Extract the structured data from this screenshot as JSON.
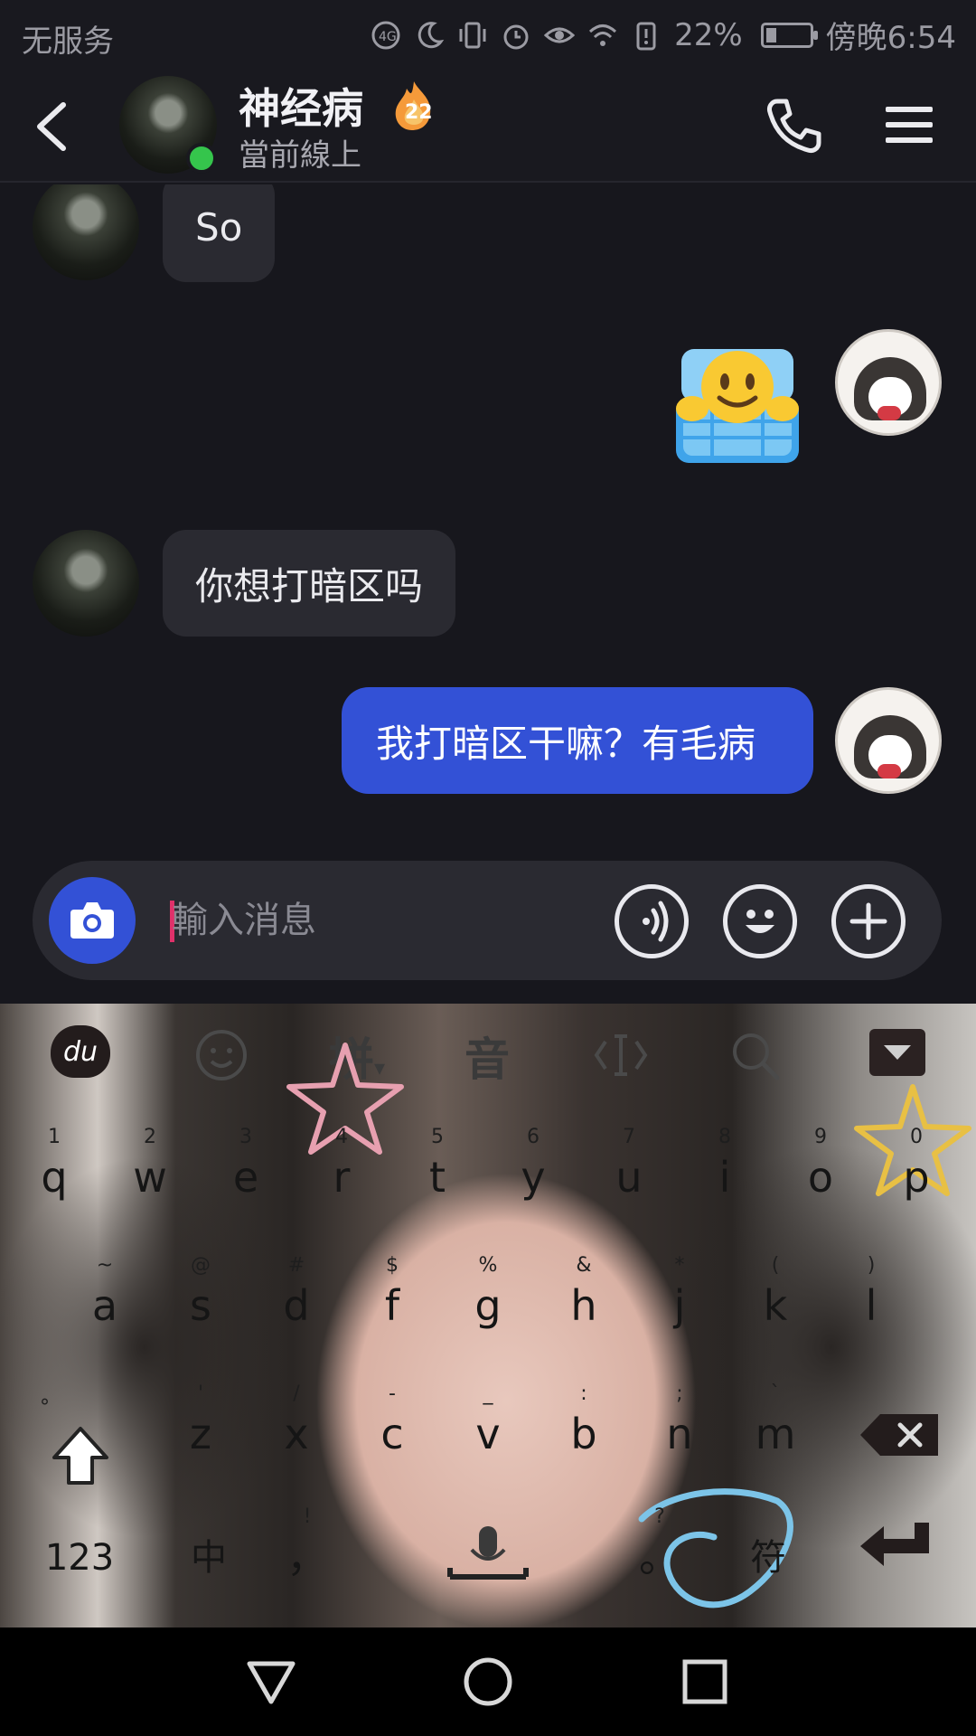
{
  "status_bar": {
    "carrier": "无服务",
    "battery": "22%",
    "time": "傍晚6:54",
    "icons": [
      "data-icon",
      "moon-icon",
      "vibrate-icon",
      "alarm-icon",
      "eye-icon",
      "wifi-icon",
      "battery-alert-icon",
      "battery-icon"
    ]
  },
  "header": {
    "name": "神经病",
    "streak": "22",
    "status": "當前線上"
  },
  "messages": [
    {
      "from": "them",
      "type": "text",
      "text": "So"
    },
    {
      "from": "me",
      "type": "sticker",
      "sticker": "emoji-in-bed-sticker"
    },
    {
      "from": "them",
      "type": "text",
      "text": "你想打暗区吗"
    },
    {
      "from": "me",
      "type": "text",
      "text": "我打暗区干嘛？有毛病"
    }
  ],
  "composer": {
    "placeholder": "輸入消息"
  },
  "keyboard": {
    "toolbar": {
      "brand": "du",
      "pinyin": "拼",
      "voice": "音"
    },
    "row1": [
      {
        "hint": "1",
        "key": "q"
      },
      {
        "hint": "2",
        "key": "w"
      },
      {
        "hint": "3",
        "key": "e"
      },
      {
        "hint": "4",
        "key": "r"
      },
      {
        "hint": "5",
        "key": "t"
      },
      {
        "hint": "6",
        "key": "y"
      },
      {
        "hint": "7",
        "key": "u"
      },
      {
        "hint": "8",
        "key": "i"
      },
      {
        "hint": "9",
        "key": "o"
      },
      {
        "hint": "0",
        "key": "p"
      }
    ],
    "row2": [
      {
        "hint": "~",
        "key": "a"
      },
      {
        "hint": "@",
        "key": "s"
      },
      {
        "hint": "#",
        "key": "d"
      },
      {
        "hint": "$",
        "key": "f"
      },
      {
        "hint": "%",
        "key": "g"
      },
      {
        "hint": "&",
        "key": "h"
      },
      {
        "hint": "*",
        "key": "j"
      },
      {
        "hint": "(",
        "key": "k"
      },
      {
        "hint": ")",
        "key": "l"
      }
    ],
    "row3": [
      {
        "hint": "'",
        "key": "z"
      },
      {
        "hint": "/",
        "key": "x"
      },
      {
        "hint": "-",
        "key": "c"
      },
      {
        "hint": "_",
        "key": "v"
      },
      {
        "hint": ":",
        "key": "b"
      },
      {
        "hint": ";",
        "key": "n"
      },
      {
        "hint": "`",
        "key": "m"
      }
    ],
    "shift_hint": "°",
    "bottom": {
      "numbers": "123",
      "lang": "中",
      "comma_hint": "!",
      "comma": "，",
      "period_hint": "?",
      "period": "。",
      "symbols": "符"
    }
  },
  "navbar": {
    "icons": [
      "back-triangle-icon",
      "home-circle-icon",
      "recents-square-icon"
    ]
  }
}
